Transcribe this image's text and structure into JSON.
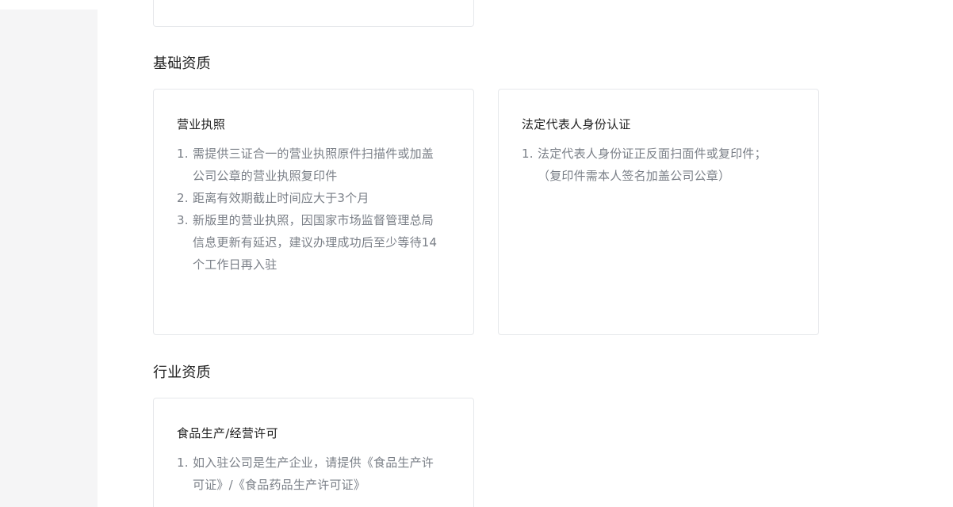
{
  "sections": [
    {
      "title": "基础资质",
      "cards": [
        {
          "title": "营业执照",
          "items": [
            {
              "num": "1.",
              "text": "需提供三证合一的营业执照原件扫描件或加盖公司公章的营业执照复印件"
            },
            {
              "num": "2.",
              "text": "距离有效期截止时间应大于3个月"
            },
            {
              "num": "3.",
              "text": "新版里的营业执照，因国家市场监督管理总局信息更新有延迟，建议办理成功后至少等待14个工作日再入驻"
            }
          ]
        },
        {
          "title": "法定代表人身份认证",
          "items": [
            {
              "num": "1.",
              "text": "法定代表人身份证正反面扫面件或复印件；（复印件需本人签名加盖公司公章）"
            }
          ]
        }
      ]
    },
    {
      "title": "行业资质",
      "cards": [
        {
          "title": "食品生产/经营许可",
          "items": [
            {
              "num": "1.",
              "text": "如入驻公司是生产企业，请提供《食品生产许可证》/《食品药品生产许可证》"
            }
          ]
        }
      ]
    }
  ],
  "colors": {
    "sidebar_bg": "#f5f5f6",
    "card_border": "#e6e8eb",
    "title_text": "#1f1f1f",
    "body_text": "#7a7f87",
    "accent": "#2f6fd6"
  }
}
